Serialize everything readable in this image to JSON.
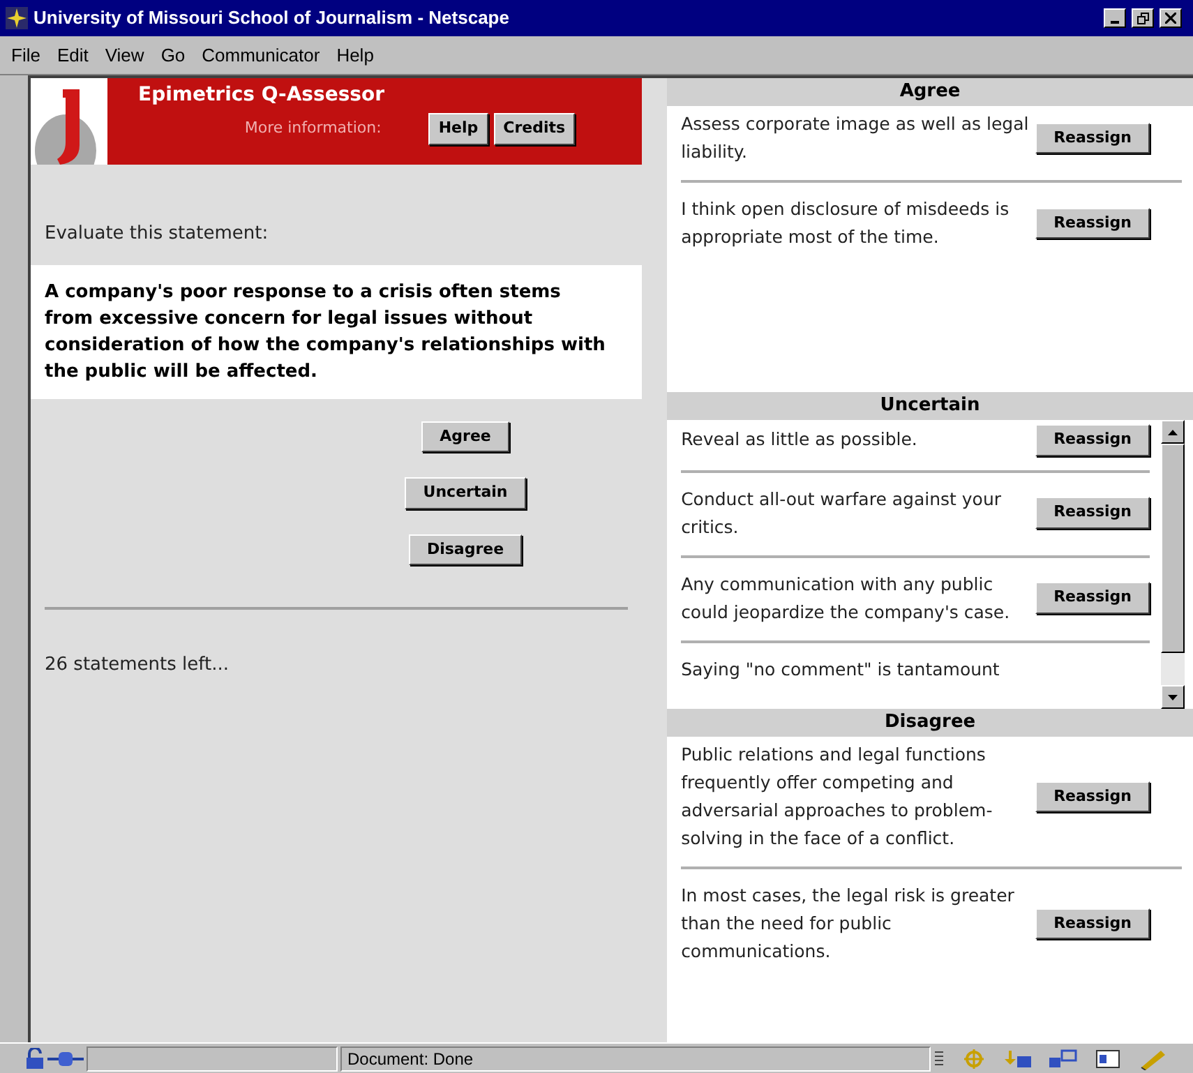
{
  "window": {
    "title": "University of Missouri School of Journalism - Netscape"
  },
  "menu": [
    "File",
    "Edit",
    "View",
    "Go",
    "Communicator",
    "Help"
  ],
  "header": {
    "title": "Epimetrics Q-Assessor",
    "info_label": "More information:",
    "buttons": [
      "Help",
      "Credits"
    ]
  },
  "evaluate": {
    "prompt": "Evaluate this statement:",
    "statement": "A company's poor response to a crisis often stems from excessive concern for legal issues without consideration of how the company's relationships with the public will be affected.",
    "buttons": [
      "Agree",
      "Uncertain",
      "Disagree"
    ],
    "remaining": "26 statements left..."
  },
  "sections": [
    {
      "title": "Agree",
      "scrollable": false,
      "items": [
        {
          "text": "Assess corporate image as well as legal liability.",
          "button": "Reassign"
        },
        {
          "text": "I think open disclosure of misdeeds is appropriate most of the time.",
          "button": "Reassign"
        }
      ]
    },
    {
      "title": "Uncertain",
      "scrollable": true,
      "items": [
        {
          "text": "Reveal as little as possible.",
          "button": "Reassign"
        },
        {
          "text": "Conduct all-out warfare against your critics.",
          "button": "Reassign"
        },
        {
          "text": "Any communication with any public could jeopardize the company's case.",
          "button": "Reassign"
        },
        {
          "text": "Saying \"no comment\" is tantamount"
        }
      ]
    },
    {
      "title": "Disagree",
      "scrollable": false,
      "items": [
        {
          "text": "Public relations and legal functions frequently offer competing and adversarial approaches to problem-solving in the face of a conflict.",
          "button": "Reassign"
        },
        {
          "text": "In most cases, the legal risk is greater than the need for public communications.",
          "button": "Reassign"
        }
      ]
    }
  ],
  "status_bar": {
    "text": "Document: Done"
  }
}
